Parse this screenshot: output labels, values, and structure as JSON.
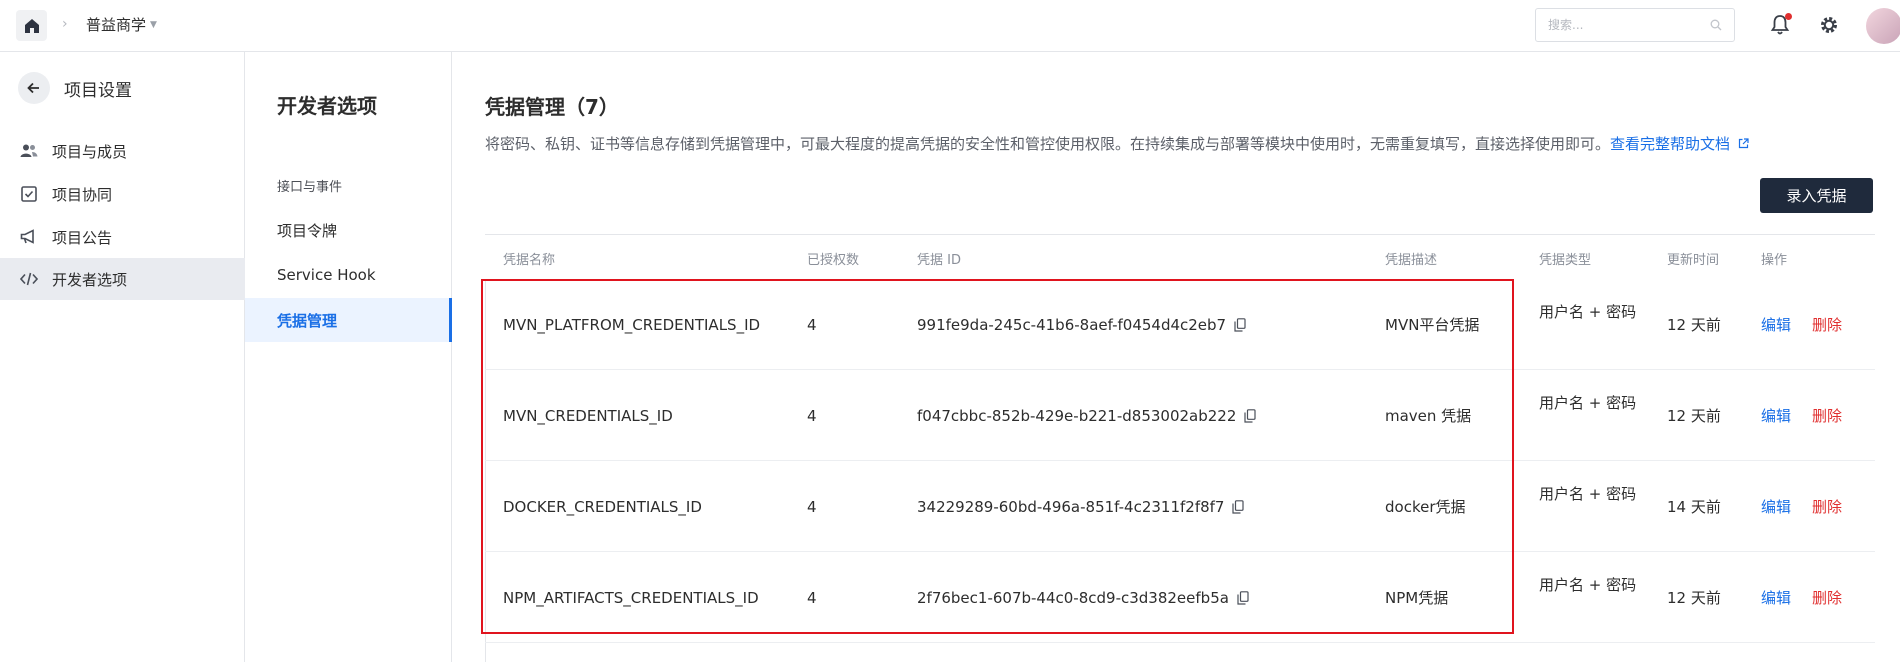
{
  "topbar": {
    "breadcrumb": "普益商学",
    "search_placeholder": "搜索..."
  },
  "sidebar": {
    "back_title": "项目设置",
    "items": [
      {
        "label": "项目与成员",
        "icon": "members-icon"
      },
      {
        "label": "项目协同",
        "icon": "checkbox-icon"
      },
      {
        "label": "项目公告",
        "icon": "megaphone-icon"
      },
      {
        "label": "开发者选项",
        "icon": "code-icon",
        "active": true
      }
    ]
  },
  "subnav": {
    "title": "开发者选项",
    "items": [
      {
        "label": "接口与事件"
      },
      {
        "label": "项目令牌"
      },
      {
        "label": "Service Hook"
      },
      {
        "label": "凭据管理",
        "active": true
      }
    ]
  },
  "main": {
    "title": "凭据管理（7）",
    "description": "将密码、私钥、证书等信息存储到凭据管理中，可最大程度的提高凭据的安全性和管控使用权限。在持续集成与部署等模块中使用时，无需重复填写，直接选择使用即可。",
    "help_link": "查看完整帮助文档",
    "add_button": "录入凭据"
  },
  "table": {
    "columns": [
      "凭据名称",
      "已授权数",
      "凭据 ID",
      "凭据描述",
      "凭据类型",
      "更新时间",
      "操作"
    ],
    "rows": [
      {
        "name": "MVN_PLATFROM_CREDENTIALS_ID",
        "count": "4",
        "id": "991fe9da-245c-41b6-8aef-f0454d4c2eb7",
        "desc": "MVN平台凭据",
        "type": "用户名 + 密码",
        "updated": "12 天前",
        "edit": "编辑",
        "delete": "删除"
      },
      {
        "name": "MVN_CREDENTIALS_ID",
        "count": "4",
        "id": "f047cbbc-852b-429e-b221-d853002ab222",
        "desc": "maven 凭据",
        "type": "用户名 + 密码",
        "updated": "12 天前",
        "edit": "编辑",
        "delete": "删除"
      },
      {
        "name": "DOCKER_CREDENTIALS_ID",
        "count": "4",
        "id": "34229289-60bd-496a-851f-4c2311f2f8f7",
        "desc": "docker凭据",
        "type": "用户名 + 密码",
        "updated": "14 天前",
        "edit": "编辑",
        "delete": "删除"
      },
      {
        "name": "NPM_ARTIFACTS_CREDENTIALS_ID",
        "count": "4",
        "id": "2f76bec1-607b-44c0-8cd9-c3d382eefb5a",
        "desc": "NPM凭据",
        "type": "用户名 + 密码",
        "updated": "12 天前",
        "edit": "编辑",
        "delete": "删除"
      }
    ]
  },
  "colors": {
    "accent": "#1a6fe6",
    "danger": "#e02f2f",
    "primary_button": "#1f2a3c",
    "highlight_border": "#e0141e"
  }
}
